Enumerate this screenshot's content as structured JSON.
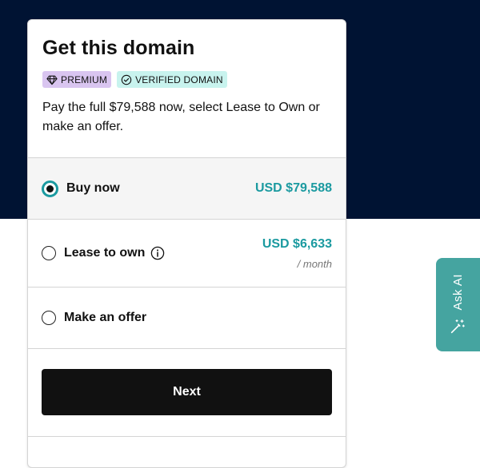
{
  "card": {
    "title": "Get this domain",
    "badges": [
      {
        "label": "PREMIUM",
        "icon": "diamond-icon",
        "color": "#d9c5f0"
      },
      {
        "label": "VERIFIED DOMAIN",
        "icon": "check-circle-icon",
        "color": "#c8f3ee"
      }
    ],
    "description": "Pay the full $79,588 now, select Lease to Own or make an offer."
  },
  "options": [
    {
      "label": "Buy now",
      "price": "USD $79,588",
      "selected": true
    },
    {
      "label": "Lease to own",
      "price": "USD $6,633",
      "unit": "/ month",
      "icon": "info-icon",
      "selected": false
    },
    {
      "label": "Make an offer",
      "selected": false
    }
  ],
  "next_button": {
    "label": "Next"
  },
  "ask_ai": {
    "label": "Ask AI",
    "icon": "magic-wand-icon"
  },
  "colors": {
    "accent": "#1b9aa0",
    "header_bg": "#001333",
    "ask_ai_bg": "#45a4a0"
  }
}
